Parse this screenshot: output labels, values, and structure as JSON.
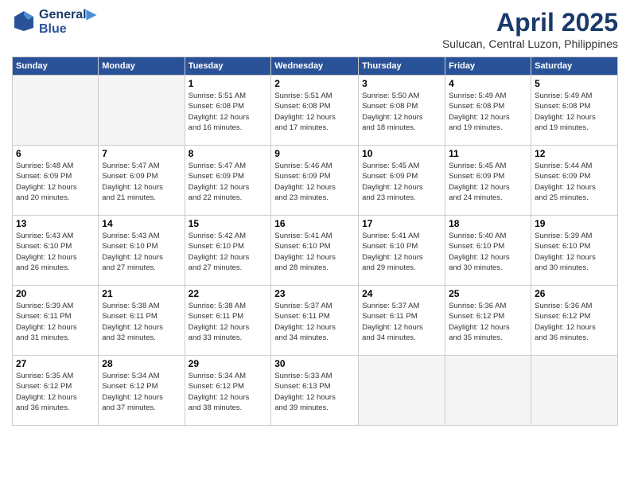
{
  "header": {
    "logo_line1": "General",
    "logo_line2": "Blue",
    "month_year": "April 2025",
    "location": "Sulucan, Central Luzon, Philippines"
  },
  "days_of_week": [
    "Sunday",
    "Monday",
    "Tuesday",
    "Wednesday",
    "Thursday",
    "Friday",
    "Saturday"
  ],
  "weeks": [
    [
      {
        "day": "",
        "info": ""
      },
      {
        "day": "",
        "info": ""
      },
      {
        "day": "1",
        "info": "Sunrise: 5:51 AM\nSunset: 6:08 PM\nDaylight: 12 hours\nand 16 minutes."
      },
      {
        "day": "2",
        "info": "Sunrise: 5:51 AM\nSunset: 6:08 PM\nDaylight: 12 hours\nand 17 minutes."
      },
      {
        "day": "3",
        "info": "Sunrise: 5:50 AM\nSunset: 6:08 PM\nDaylight: 12 hours\nand 18 minutes."
      },
      {
        "day": "4",
        "info": "Sunrise: 5:49 AM\nSunset: 6:08 PM\nDaylight: 12 hours\nand 19 minutes."
      },
      {
        "day": "5",
        "info": "Sunrise: 5:49 AM\nSunset: 6:08 PM\nDaylight: 12 hours\nand 19 minutes."
      }
    ],
    [
      {
        "day": "6",
        "info": "Sunrise: 5:48 AM\nSunset: 6:09 PM\nDaylight: 12 hours\nand 20 minutes."
      },
      {
        "day": "7",
        "info": "Sunrise: 5:47 AM\nSunset: 6:09 PM\nDaylight: 12 hours\nand 21 minutes."
      },
      {
        "day": "8",
        "info": "Sunrise: 5:47 AM\nSunset: 6:09 PM\nDaylight: 12 hours\nand 22 minutes."
      },
      {
        "day": "9",
        "info": "Sunrise: 5:46 AM\nSunset: 6:09 PM\nDaylight: 12 hours\nand 23 minutes."
      },
      {
        "day": "10",
        "info": "Sunrise: 5:45 AM\nSunset: 6:09 PM\nDaylight: 12 hours\nand 23 minutes."
      },
      {
        "day": "11",
        "info": "Sunrise: 5:45 AM\nSunset: 6:09 PM\nDaylight: 12 hours\nand 24 minutes."
      },
      {
        "day": "12",
        "info": "Sunrise: 5:44 AM\nSunset: 6:09 PM\nDaylight: 12 hours\nand 25 minutes."
      }
    ],
    [
      {
        "day": "13",
        "info": "Sunrise: 5:43 AM\nSunset: 6:10 PM\nDaylight: 12 hours\nand 26 minutes."
      },
      {
        "day": "14",
        "info": "Sunrise: 5:43 AM\nSunset: 6:10 PM\nDaylight: 12 hours\nand 27 minutes."
      },
      {
        "day": "15",
        "info": "Sunrise: 5:42 AM\nSunset: 6:10 PM\nDaylight: 12 hours\nand 27 minutes."
      },
      {
        "day": "16",
        "info": "Sunrise: 5:41 AM\nSunset: 6:10 PM\nDaylight: 12 hours\nand 28 minutes."
      },
      {
        "day": "17",
        "info": "Sunrise: 5:41 AM\nSunset: 6:10 PM\nDaylight: 12 hours\nand 29 minutes."
      },
      {
        "day": "18",
        "info": "Sunrise: 5:40 AM\nSunset: 6:10 PM\nDaylight: 12 hours\nand 30 minutes."
      },
      {
        "day": "19",
        "info": "Sunrise: 5:39 AM\nSunset: 6:10 PM\nDaylight: 12 hours\nand 30 minutes."
      }
    ],
    [
      {
        "day": "20",
        "info": "Sunrise: 5:39 AM\nSunset: 6:11 PM\nDaylight: 12 hours\nand 31 minutes."
      },
      {
        "day": "21",
        "info": "Sunrise: 5:38 AM\nSunset: 6:11 PM\nDaylight: 12 hours\nand 32 minutes."
      },
      {
        "day": "22",
        "info": "Sunrise: 5:38 AM\nSunset: 6:11 PM\nDaylight: 12 hours\nand 33 minutes."
      },
      {
        "day": "23",
        "info": "Sunrise: 5:37 AM\nSunset: 6:11 PM\nDaylight: 12 hours\nand 34 minutes."
      },
      {
        "day": "24",
        "info": "Sunrise: 5:37 AM\nSunset: 6:11 PM\nDaylight: 12 hours\nand 34 minutes."
      },
      {
        "day": "25",
        "info": "Sunrise: 5:36 AM\nSunset: 6:12 PM\nDaylight: 12 hours\nand 35 minutes."
      },
      {
        "day": "26",
        "info": "Sunrise: 5:36 AM\nSunset: 6:12 PM\nDaylight: 12 hours\nand 36 minutes."
      }
    ],
    [
      {
        "day": "27",
        "info": "Sunrise: 5:35 AM\nSunset: 6:12 PM\nDaylight: 12 hours\nand 36 minutes."
      },
      {
        "day": "28",
        "info": "Sunrise: 5:34 AM\nSunset: 6:12 PM\nDaylight: 12 hours\nand 37 minutes."
      },
      {
        "day": "29",
        "info": "Sunrise: 5:34 AM\nSunset: 6:12 PM\nDaylight: 12 hours\nand 38 minutes."
      },
      {
        "day": "30",
        "info": "Sunrise: 5:33 AM\nSunset: 6:13 PM\nDaylight: 12 hours\nand 39 minutes."
      },
      {
        "day": "",
        "info": ""
      },
      {
        "day": "",
        "info": ""
      },
      {
        "day": "",
        "info": ""
      }
    ]
  ]
}
